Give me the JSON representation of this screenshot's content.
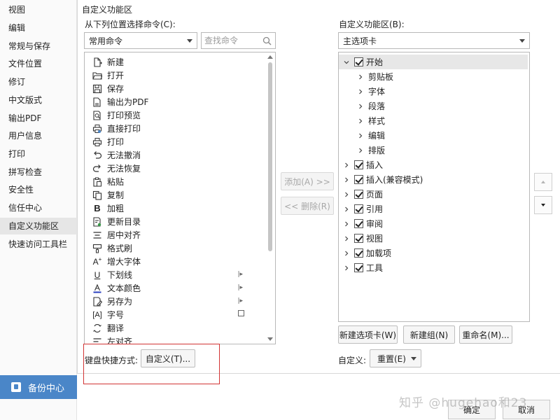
{
  "nav": {
    "items": [
      {
        "label": "视图"
      },
      {
        "label": "编辑"
      },
      {
        "label": "常规与保存"
      },
      {
        "label": "文件位置"
      },
      {
        "label": "修订"
      },
      {
        "label": "中文版式"
      },
      {
        "label": "输出PDF"
      },
      {
        "label": "用户信息"
      },
      {
        "label": "打印"
      },
      {
        "label": "拼写检查"
      },
      {
        "label": "安全性"
      },
      {
        "label": "信任中心"
      },
      {
        "label": "自定义功能区"
      },
      {
        "label": "快速访问工具栏"
      }
    ],
    "active_index": 12,
    "backup_label": "备份中心"
  },
  "main": {
    "section_title": "自定义功能区",
    "left_label": "从下列位置选择命令(C):",
    "left_select_value": "常用命令",
    "search_placeholder": "查找命令",
    "right_label": "自定义功能区(B):",
    "right_select_value": "主选项卡",
    "commands": [
      {
        "label": "新建",
        "icon": "new-doc-icon"
      },
      {
        "label": "打开",
        "icon": "folder-icon"
      },
      {
        "label": "保存",
        "icon": "save-icon"
      },
      {
        "label": "输出为PDF",
        "icon": "pdf-icon"
      },
      {
        "label": "打印预览",
        "icon": "print-preview-icon"
      },
      {
        "label": "直接打印",
        "icon": "direct-print-icon"
      },
      {
        "label": "打印",
        "icon": "print-icon"
      },
      {
        "label": "无法撤消",
        "icon": "undo-icon"
      },
      {
        "label": "无法恢复",
        "icon": "redo-icon"
      },
      {
        "label": "粘贴",
        "icon": "paste-icon"
      },
      {
        "label": "复制",
        "icon": "copy-icon"
      },
      {
        "label": "加粗",
        "icon": "bold-icon"
      },
      {
        "label": "更新目录",
        "icon": "update-toc-icon"
      },
      {
        "label": "居中对齐",
        "icon": "align-center-icon"
      },
      {
        "label": "格式刷",
        "icon": "format-painter-icon"
      },
      {
        "label": "增大字体",
        "icon": "increase-font-icon"
      },
      {
        "label": "下划线",
        "icon": "underline-icon",
        "submenu": "split"
      },
      {
        "label": "文本颜色",
        "icon": "text-color-icon",
        "submenu": "split"
      },
      {
        "label": "另存为",
        "icon": "save-as-icon",
        "submenu": "split"
      },
      {
        "label": "字号",
        "icon": "font-size-icon",
        "submenu": "dropdown"
      },
      {
        "label": "翻译",
        "icon": "translate-icon"
      },
      {
        "label": "左对齐",
        "icon": "align-left-icon"
      }
    ],
    "add_button": "添加(A) >>",
    "remove_button": "<< 删除(R)",
    "tabs_tree": [
      {
        "label": "开始",
        "level": 0,
        "expanded": true,
        "checked": true,
        "selected": true
      },
      {
        "label": "剪贴板",
        "level": 1
      },
      {
        "label": "字体",
        "level": 1
      },
      {
        "label": "段落",
        "level": 1
      },
      {
        "label": "样式",
        "level": 1
      },
      {
        "label": "编辑",
        "level": 1
      },
      {
        "label": "排版",
        "level": 1
      },
      {
        "label": "插入",
        "level": 0,
        "checked": true
      },
      {
        "label": "插入(兼容模式)",
        "level": 0,
        "checked": true
      },
      {
        "label": "页面",
        "level": 0,
        "checked": true
      },
      {
        "label": "引用",
        "level": 0,
        "checked": true
      },
      {
        "label": "审阅",
        "level": 0,
        "checked": true
      },
      {
        "label": "视图",
        "level": 0,
        "checked": true
      },
      {
        "label": "加载项",
        "level": 0,
        "checked": true
      },
      {
        "label": "工具",
        "level": 0,
        "checked": true
      }
    ],
    "new_tab_button": "新建选项卡(W)",
    "new_group_button": "新建组(N)",
    "rename_button": "重命名(M)...",
    "shortcut_label": "键盘快捷方式:",
    "shortcut_button": "自定义(T)...",
    "customize_label": "自定义:",
    "reset_button": "重置(E)",
    "highlight_color": "#d23434"
  },
  "footer": {
    "ok_button": "确定",
    "cancel_button": "取消",
    "watermark": "知乎 @hugehao和23"
  }
}
